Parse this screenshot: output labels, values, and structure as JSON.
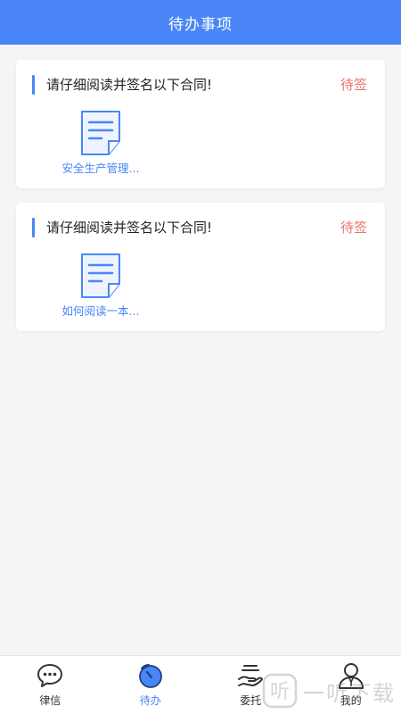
{
  "header": {
    "title": "待办事项"
  },
  "todos": [
    {
      "title": "请仔细阅读并签名以下合同!",
      "status": "待签",
      "document": {
        "name": "安全生产管理...",
        "icon": "document-icon"
      }
    },
    {
      "title": "请仔细阅读并签名以下合同!",
      "status": "待签",
      "document": {
        "name": "如何阅读一本...",
        "icon": "document-icon"
      }
    }
  ],
  "tabbar": {
    "items": [
      {
        "label": "律信",
        "icon": "chat-bubble-icon",
        "active": false
      },
      {
        "label": "待办",
        "icon": "todo-icon",
        "active": true
      },
      {
        "label": "委托",
        "icon": "hand-icon",
        "active": false
      },
      {
        "label": "我的",
        "icon": "user-icon",
        "active": false
      }
    ]
  },
  "watermark": {
    "text": "一听下载",
    "icon": "watermark-logo-icon"
  },
  "colors": {
    "accent": "#4a86f7",
    "status": "#e8736f",
    "background": "#f5f5f7"
  }
}
